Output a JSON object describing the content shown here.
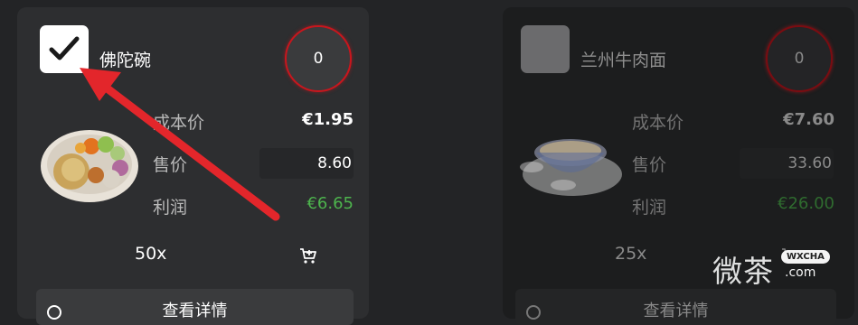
{
  "items": [
    {
      "name": "佛陀碗",
      "quantity": "0",
      "checked": true,
      "cost_label": "成本价",
      "cost_value": "€1.95",
      "price_label": "售价",
      "price_value": "8.60",
      "profit_label": "利润",
      "profit_value": "€6.65",
      "count": "50x",
      "details_label": "查看详情"
    },
    {
      "name": "兰州牛肉面",
      "quantity": "0",
      "checked": false,
      "cost_label": "成本价",
      "cost_value": "€7.60",
      "price_label": "售价",
      "price_value": "33.60",
      "profit_label": "利润",
      "profit_value": "€26.00",
      "count": "25x",
      "details_label": "查看详情"
    }
  ],
  "icons": {
    "checkmark": "check-icon",
    "cart": "add-to-cart-icon",
    "annotation": "red-arrow"
  },
  "colors": {
    "background": "#232426",
    "card_active": "#2d2e30",
    "card_inactive": "#1c1d1e",
    "profit_green": "#4db44d",
    "quantity_ring": "#c8161d",
    "arrow_red": "#e3262b"
  },
  "watermark": {
    "text": "微茶",
    "badge": "WXCHA",
    "url": ".com"
  }
}
